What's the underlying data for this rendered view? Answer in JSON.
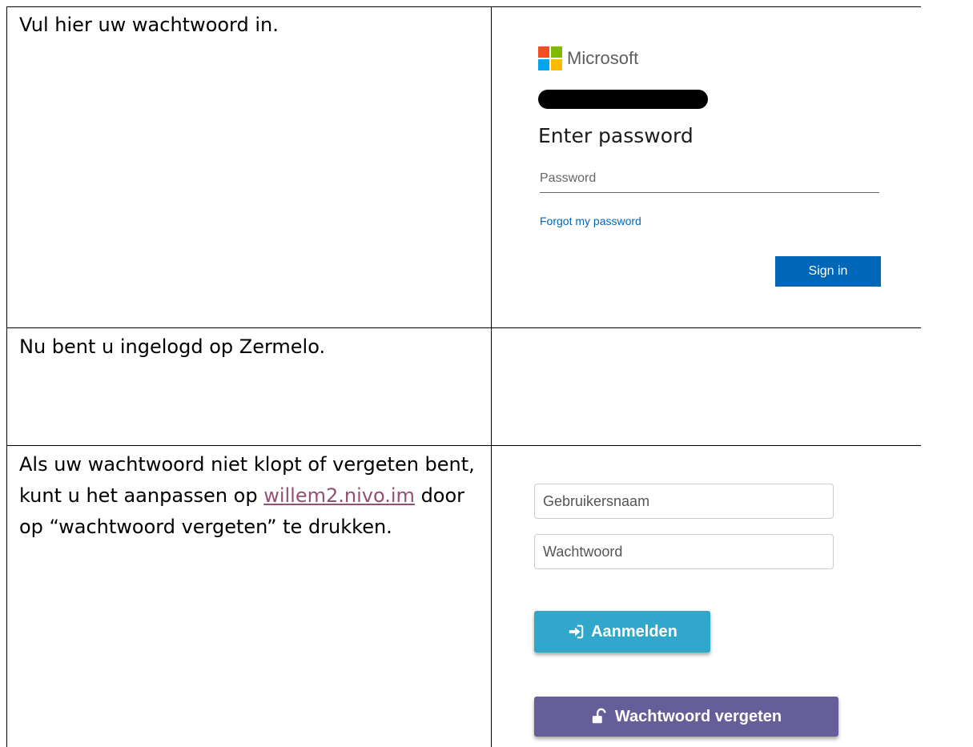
{
  "rows": [
    {
      "instruction": "Vul hier uw wachtwoord in."
    },
    {
      "instruction": "Nu bent u ingelogd op Zermelo."
    },
    {
      "instruction_before_link": "Als uw wachtwoord niet klopt of vergeten bent, kunt u het aanpassen op",
      "link_text": "willem2.nivo.im",
      "instruction_after_link": "door op “wachtwoord vergeten” te drukken."
    }
  ],
  "microsoft_signin": {
    "brand": "Microsoft",
    "heading": "Enter password",
    "password_placeholder": "Password",
    "forgot_link": "Forgot my password",
    "signin_button": "Sign in",
    "colors": {
      "accent": "#0067b8",
      "logo": [
        "#f25022",
        "#7fba00",
        "#00a4ef",
        "#ffb900"
      ]
    },
    "redacted_field": "black-redaction-bar"
  },
  "nivo_login": {
    "username_placeholder": "Gebruikersnaam",
    "password_placeholder": "Wachtwoord",
    "login_button": "Aanmelden",
    "login_icon": "sign-in-icon",
    "forgot_button": "Wachtwoord vergeten",
    "forgot_icon": "unlock-icon",
    "colors": {
      "login": "#31a7cb",
      "forgot": "#665e98"
    }
  }
}
